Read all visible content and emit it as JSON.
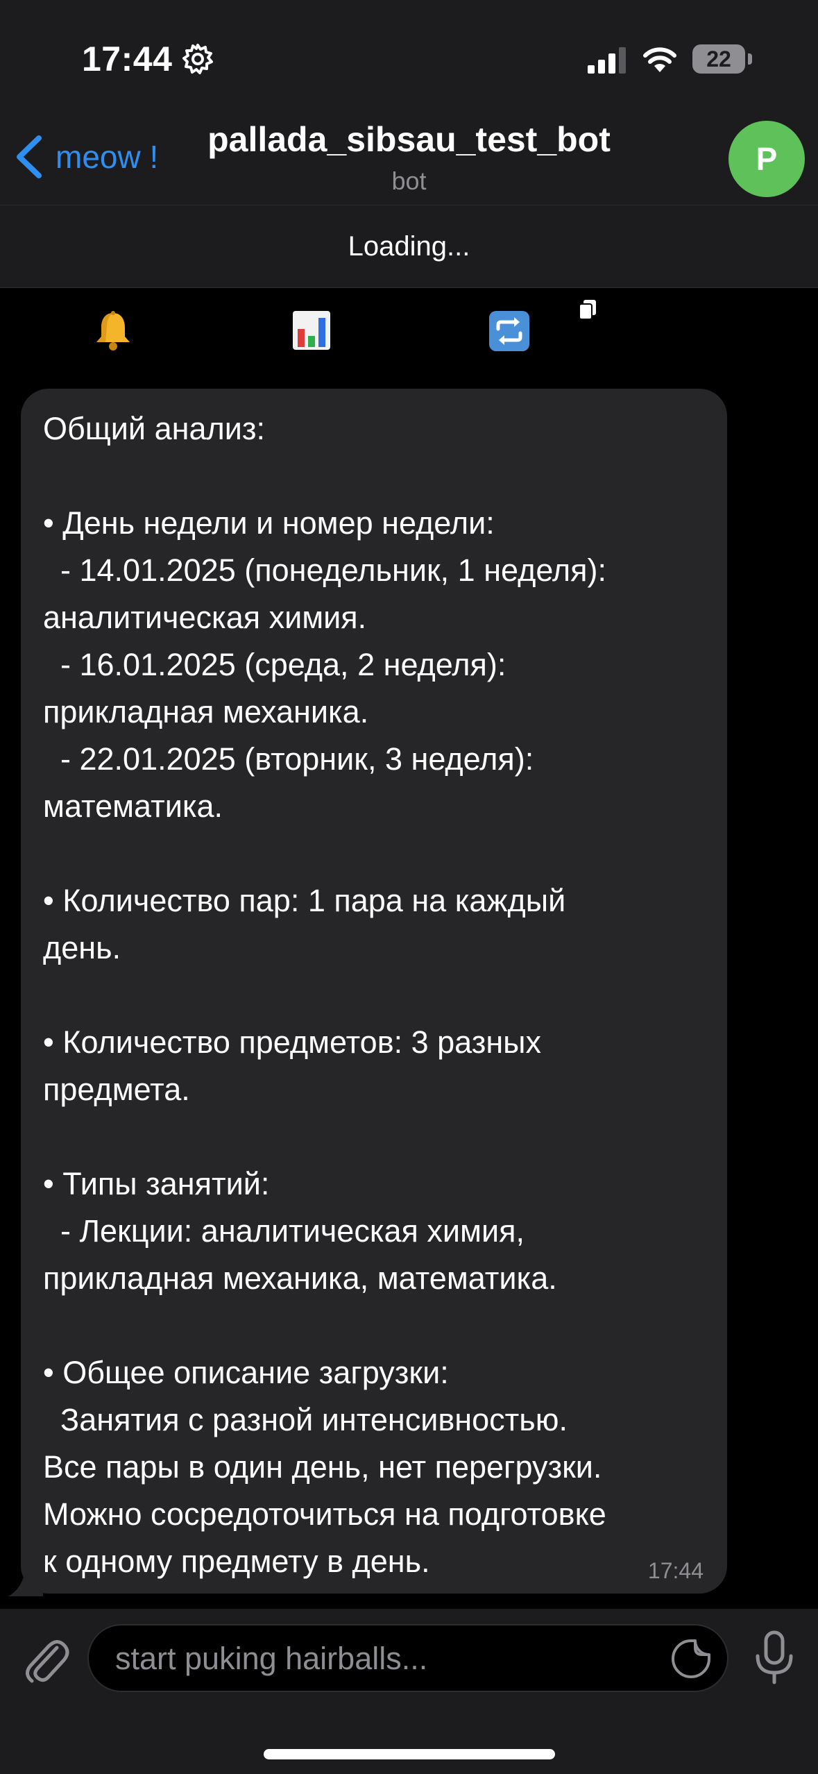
{
  "status_bar": {
    "time": "17:44",
    "battery": "22",
    "icons": [
      "gear-icon",
      "signal-icon",
      "wifi-icon",
      "battery-icon"
    ]
  },
  "nav": {
    "back_label": "meow !",
    "title": "pallada_sibsau_test_bot",
    "subtitle": "bot",
    "avatar_letter": "P"
  },
  "loading_text": "Loading...",
  "toolbar": {
    "icons": [
      "bell-icon",
      "chart-icon",
      "repeat-icon",
      "pages-icon"
    ]
  },
  "message": {
    "text": "Общий анализ:\n\n• День недели и номер недели:\n  - 14.01.2025 (понедельник, 1 неделя):\nаналитическая химия.\n  - 16.01.2025 (среда, 2 неделя):\nприкладная механика.\n  - 22.01.2025 (вторник, 3 неделя):\nматематика.\n\n• Количество пар: 1 пара на каждый\nдень.\n\n• Количество предметов: 3 разных\nпредмета.\n\n• Типы занятий:\n  - Лекции: аналитическая химия,\nприкладная механика, математика.\n\n• Общее описание загрузки:\n  Занятия с разной интенсивностью.\nВсе пары в один день, нет перегрузки.\nМожно сосредоточиться на подготовке\nк одному предмету в день.",
    "time": "17:44"
  },
  "input": {
    "placeholder": "start puking hairballs..."
  },
  "colors": {
    "accent": "#2f8ff0",
    "avatar": "#5fc15a",
    "bubble": "#262628",
    "bar": "#1c1c1e",
    "secondary_text": "#8e8e93"
  }
}
